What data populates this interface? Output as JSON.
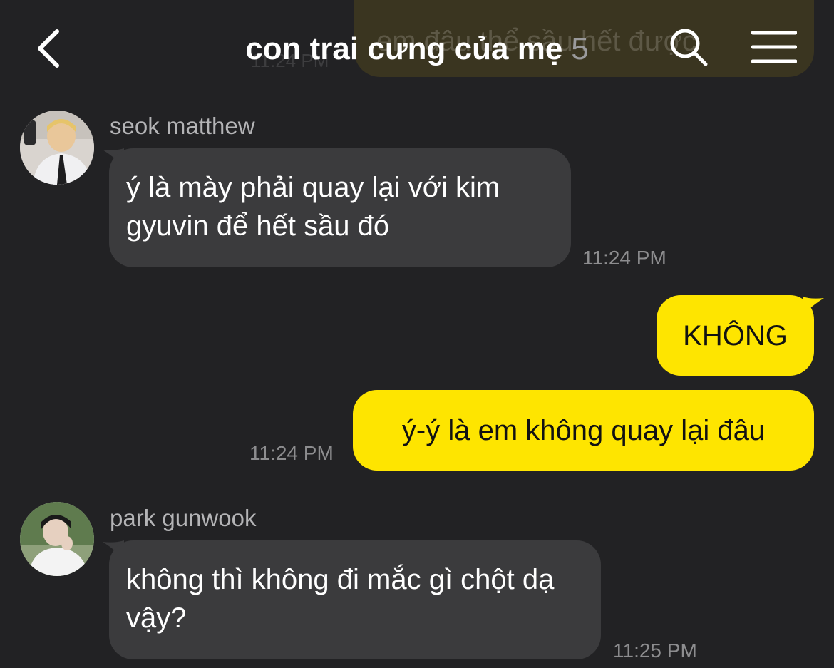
{
  "header": {
    "title": "con trai cưng của mẹ",
    "member_count": "5"
  },
  "ghost": {
    "text": "em đâu thể sầu hết được",
    "time": "11:24 PM"
  },
  "messages": [
    {
      "sender": "seok matthew",
      "text": "ý là mày phải quay lại với kim gyuvin để hết sầu đó",
      "time": "11:24 PM"
    },
    {
      "text": "KHÔNG"
    },
    {
      "text": "ý-ý là em không quay lại đâu",
      "time": "11:24 PM"
    },
    {
      "sender": "park gunwook",
      "text": "không thì không đi mắc gì chột dạ vậy?",
      "time": "11:25 PM"
    }
  ],
  "colors": {
    "background": "#222224",
    "incoming_bubble": "#3b3b3d",
    "outgoing_bubble": "#fee500"
  },
  "icons": [
    "back-chevron-icon",
    "search-icon",
    "menu-icon"
  ]
}
